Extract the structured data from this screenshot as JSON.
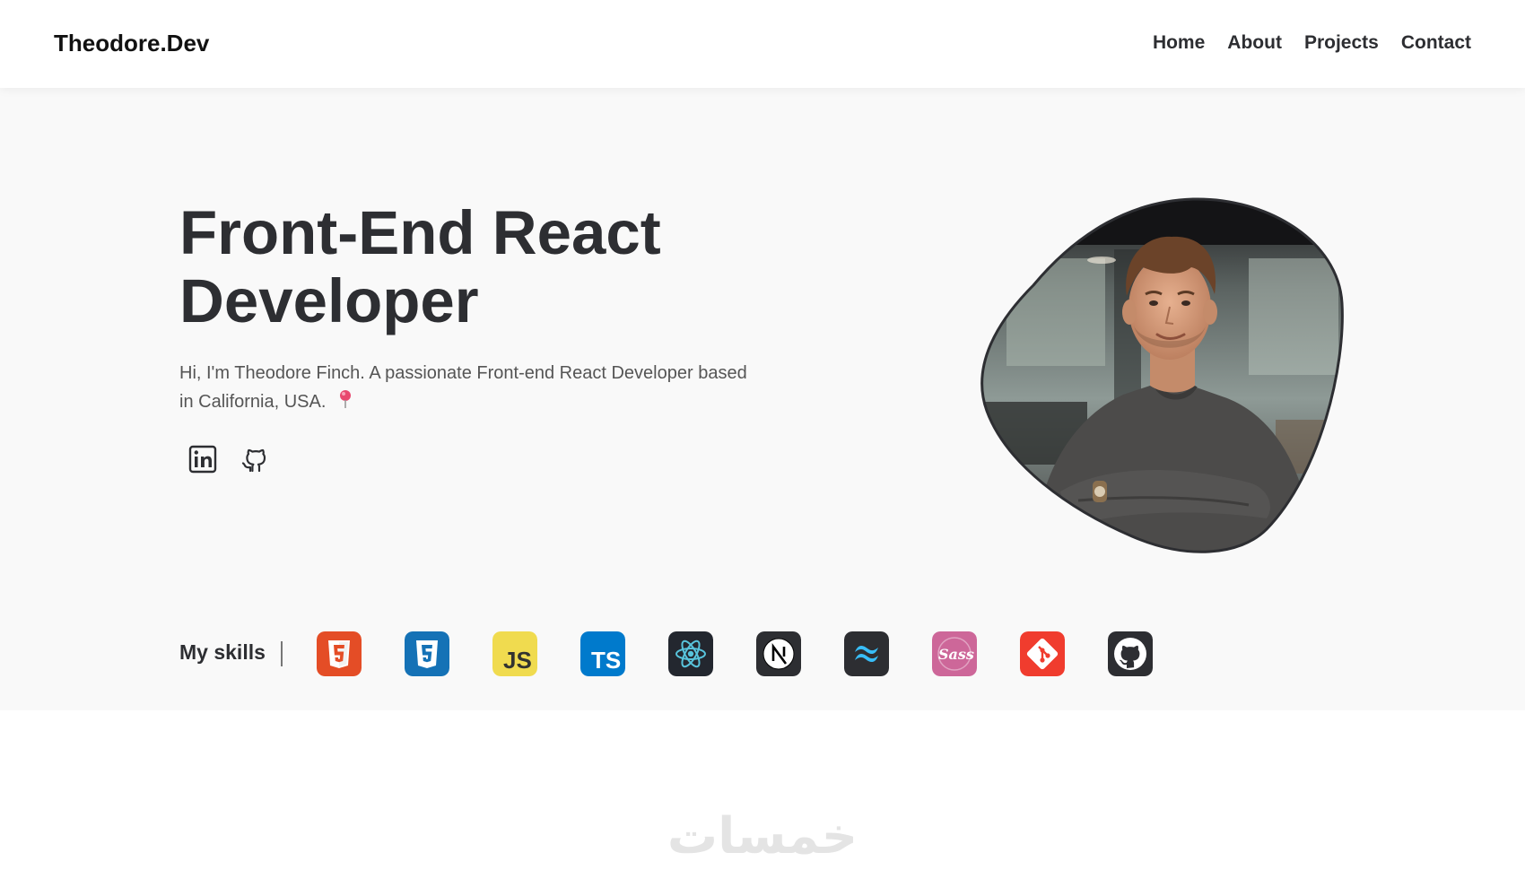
{
  "navbar": {
    "logo": "Theodore.Dev",
    "links": [
      "Home",
      "About",
      "Projects",
      "Contact"
    ]
  },
  "hero": {
    "title": "Front-End React Developer",
    "intro": "Hi, I'm Theodore Finch. A passionate Front-end React Developer based in California, USA.",
    "location_icon": "map-pin-icon",
    "socials": [
      {
        "name": "linkedin-icon"
      },
      {
        "name": "github-icon"
      }
    ]
  },
  "skills": {
    "label": "My skills",
    "items": [
      {
        "icon": "html5-icon",
        "color": "#e44d26",
        "text": "5"
      },
      {
        "icon": "css3-icon",
        "color": "#1572b6",
        "text": "3"
      },
      {
        "icon": "javascript-icon",
        "color": "#f0db4f",
        "text": "JS"
      },
      {
        "icon": "typescript-icon",
        "color": "#007acc",
        "text": "TS"
      },
      {
        "icon": "react-icon",
        "color": "#23272f"
      },
      {
        "icon": "nextjs-icon",
        "color": "#2d2e32",
        "text": "N"
      },
      {
        "icon": "tailwind-icon",
        "color": "#2d2e32"
      },
      {
        "icon": "sass-icon",
        "color": "#cd6799",
        "text": "Sass"
      },
      {
        "icon": "git-icon",
        "color": "#f03c2e"
      },
      {
        "icon": "github-icon",
        "color": "#2d2e32"
      }
    ]
  },
  "watermark": "خمسات"
}
